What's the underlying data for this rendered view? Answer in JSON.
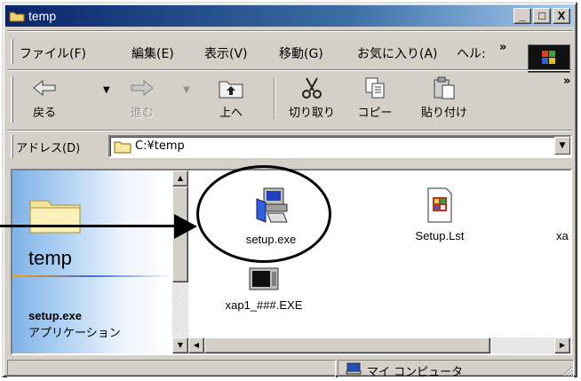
{
  "window": {
    "title": "temp",
    "controls": {
      "minimize": "_",
      "maximize": "□",
      "close": "X"
    }
  },
  "menu": {
    "items": [
      "ファイル(F)",
      "編集(E)",
      "表示(V)",
      "移動(G)",
      "お気に入り(A)",
      "ヘル:"
    ],
    "overflow": "»"
  },
  "toolbar": {
    "buttons": [
      {
        "label": "戻る",
        "icon": "back-arrow-icon",
        "enabled": true
      },
      {
        "label": "進む",
        "icon": "forward-arrow-icon",
        "enabled": false
      },
      {
        "label": "上へ",
        "icon": "up-folder-icon",
        "enabled": true
      },
      {
        "label": "切り取り",
        "icon": "scissors-icon",
        "enabled": true
      },
      {
        "label": "コピー",
        "icon": "copy-icon",
        "enabled": true
      },
      {
        "label": "貼り付け",
        "icon": "paste-icon",
        "enabled": true
      }
    ],
    "overflow": "»"
  },
  "address": {
    "label": "アドレス(D)",
    "value": "C:¥temp",
    "dropdown": "▼"
  },
  "left_pane": {
    "title": "temp",
    "selected_name": "setup.exe",
    "selected_type": "アプリケーション"
  },
  "files": [
    {
      "name": "setup.exe",
      "icon": "setup-installer-icon"
    },
    {
      "name": "Setup.Lst",
      "icon": "setup-list-icon"
    },
    {
      "name": "xa",
      "icon": "truncated-file-icon"
    },
    {
      "name": "xap1_###.EXE",
      "icon": "dos-executable-icon"
    }
  ],
  "scroll": {
    "up": "▲",
    "down": "▼",
    "left": "◀",
    "right": "▶"
  },
  "status": {
    "location": "マイ コンピュータ"
  },
  "colors": {
    "title_start": "#0a246a",
    "title_end": "#a6caf0",
    "chrome": "#d4d0c8"
  }
}
